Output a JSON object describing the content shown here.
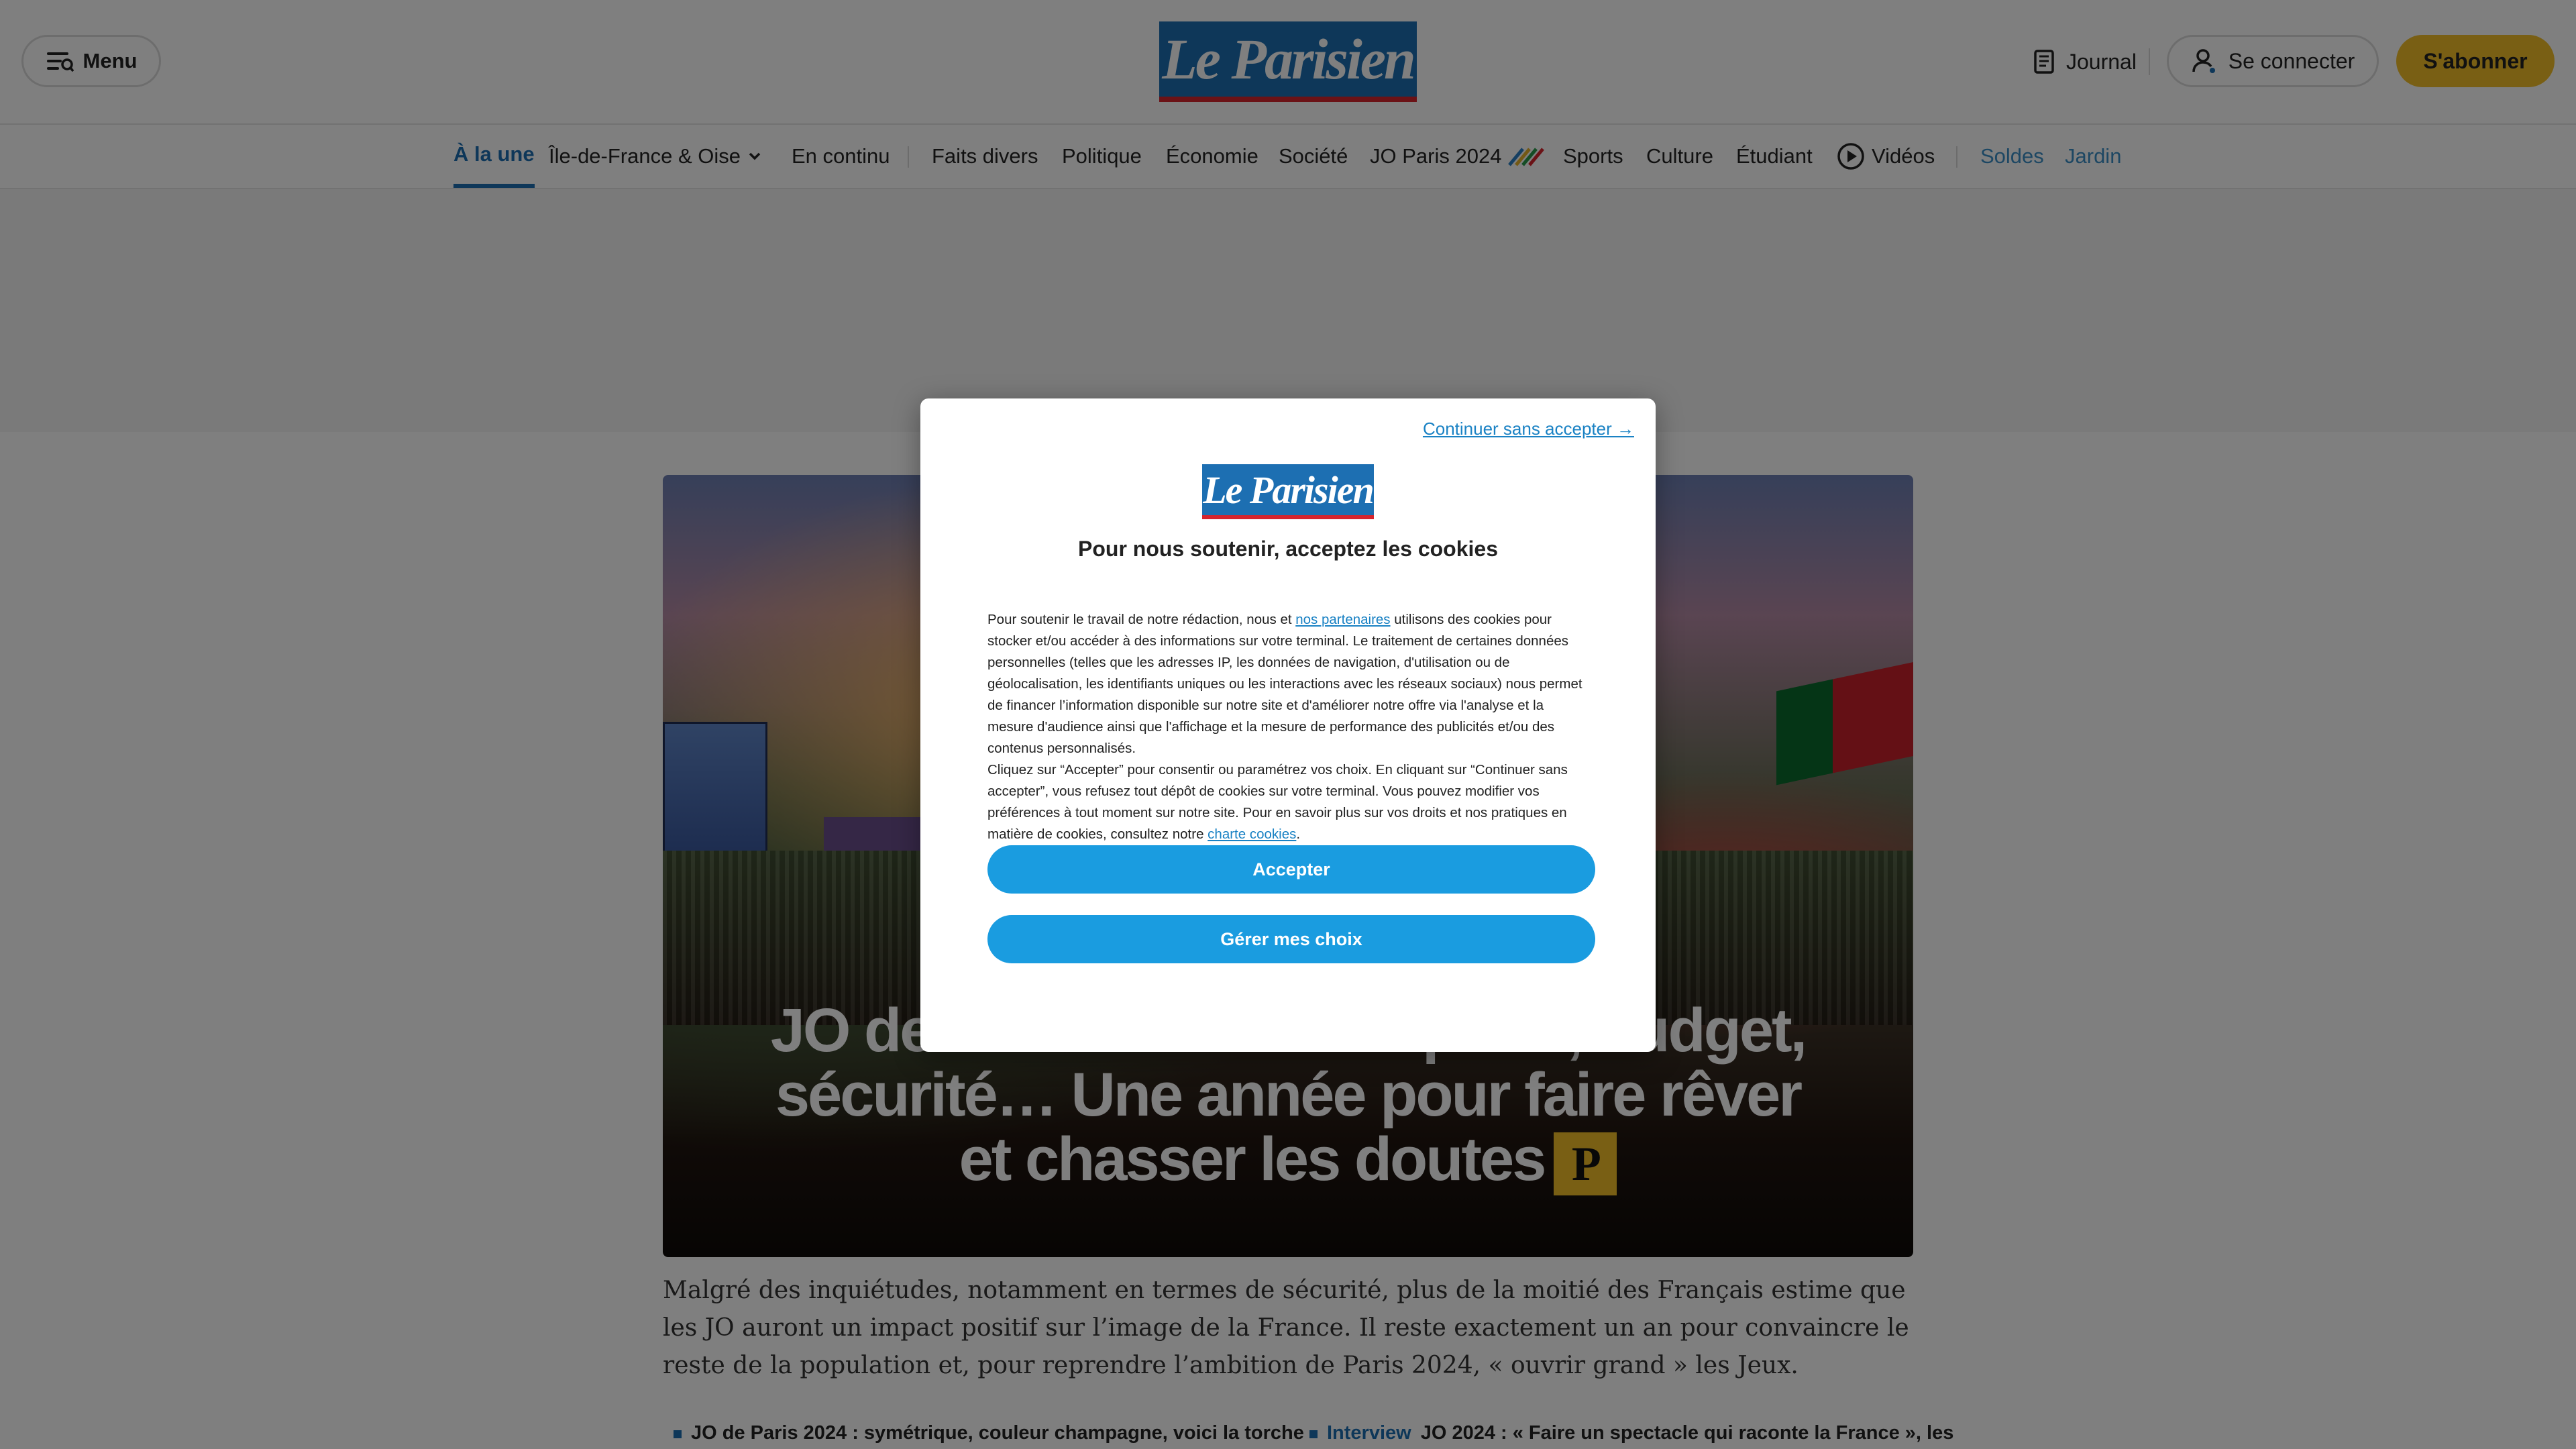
{
  "header": {
    "menu_label": "Menu",
    "logo_text": "Le Parisien",
    "journal_label": "Journal",
    "login_label": "Se connecter",
    "subscribe_label": "S'abonner"
  },
  "nav": {
    "items": [
      {
        "label": "À la une"
      },
      {
        "label": "Île-de-France & Oise"
      },
      {
        "label": "En continu"
      },
      {
        "label": "Faits divers"
      },
      {
        "label": "Politique"
      },
      {
        "label": "Économie"
      },
      {
        "label": "Société"
      },
      {
        "label": "JO Paris 2024"
      },
      {
        "label": "Sports"
      },
      {
        "label": "Culture"
      },
      {
        "label": "Étudiant"
      },
      {
        "label": "Vidéos"
      },
      {
        "label": "Soldes"
      },
      {
        "label": "Jardin"
      }
    ]
  },
  "hero": {
    "title": "JO de Paris 2024 : transports, budget, sécurité… Une année pour faire rêver et chasser les doutes",
    "badge": "P"
  },
  "article": {
    "lead": "Malgré des inquiétudes, notamment en termes de sécurité, plus de la moitié des Français estime que les JO auront un impact positif sur l’image de la France. Il reste exactement un an pour convaincre le reste de la population et, pour reprendre l’ambition de Paris 2024, « ouvrir grand » les Jeux.",
    "related": [
      {
        "tag": "",
        "text": "JO de Paris 2024 : symétrique, couleur champagne, voici la torche"
      },
      {
        "tag": "Interview",
        "text": "JO 2024 : « Faire un spectacle qui raconte la France », les"
      }
    ]
  },
  "consent": {
    "continue_label": "Continuer sans accepter →",
    "logo_text": "Le Parisien",
    "title": "Pour nous soutenir, acceptez les cookies",
    "para1_before": "Pour soutenir le travail de notre rédaction, nous et ",
    "para1_link": "nos partenaires",
    "para1_after": " utilisons des cookies pour stocker et/ou accéder à des informations sur votre terminal. Le traitement de certaines données personnelles (telles que les adresses IP, les données de navigation, d'utilisation ou de géolocalisation, les identifiants uniques ou les interactions avec les réseaux sociaux) nous permet de financer l’information disponible sur notre site et d'améliorer notre offre via l'analyse et la mesure d'audience ainsi que l'affichage et la mesure de performance des publicités et/ou des contenus personnalisés.",
    "para2_before": "Cliquez sur “Accepter” pour consentir ou paramétrez vos choix. En cliquant sur “Continuer sans accepter”, vous refusez tout dépôt de cookies sur votre terminal. Vous pouvez modifier vos préférences à tout moment sur notre site. Pour en savoir plus sur vos droits et nos pratiques en matière de cookies, consultez notre ",
    "para2_link": "charte cookies",
    "para2_after": ".",
    "accept_label": "Accepter",
    "manage_label": "Gérer mes choix"
  },
  "colors": {
    "brand_blue": "#1d6fb2",
    "subscribe_yellow": "#f2bf29",
    "consent_button": "#1a9ce0"
  }
}
